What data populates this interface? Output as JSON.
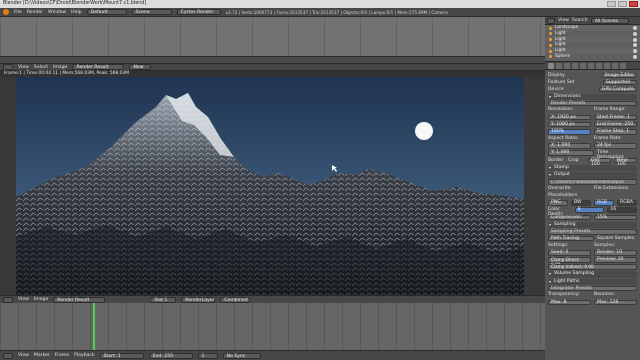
{
  "window": {
    "title": "Blender [D:\\Videos\\CF\\Droid\\BlenderWork\\Mount7.c1.blend]"
  },
  "info_header": {
    "menus": [
      "File",
      "Render",
      "Window",
      "Help"
    ],
    "layout": "Default",
    "scene": "Scene",
    "engine": "Cycles Render",
    "stats": "v2.72 | Verts:1006773 | Faces:2013537 | Tris:2013537 | Objects:0/4 | Lamps:0/1 | Mem:575.69M | Camera"
  },
  "image_editor": {
    "menus": [
      "View",
      "Select",
      "Image"
    ],
    "image_name": "Render Result",
    "slot": "New",
    "info": "Frame:1 | Time:00:04.11 | Mem:568.03M, Peak: 568.03M"
  },
  "bottom_editor": {
    "menus": [
      "View",
      "Image"
    ],
    "image_name": "Render Result",
    "slot": "Slot 1",
    "layer": "RenderLayer",
    "pass": "Combined"
  },
  "timeline": {
    "menus": [
      "View",
      "Marker",
      "Frame",
      "Playback"
    ],
    "start_label": "Start:",
    "start": "1",
    "end_label": "End:",
    "end": "250",
    "current": "1",
    "sync": "No Sync"
  },
  "outliner": {
    "menus": [
      "View",
      "Search"
    ],
    "filter": "All Scenes",
    "items": [
      "Landscape",
      "Light",
      "Light",
      "Light",
      "Light",
      "Sphere"
    ]
  },
  "properties": {
    "display_label": "Display",
    "display": "Image Editor",
    "feature_set_label": "Feature Set",
    "feature_set": "Supported",
    "device_label": "Device",
    "device": "GPU Compute",
    "dimensions": "Dimensions",
    "render_presets": "Render Presets",
    "resolution_label": "Resolution:",
    "frame_range_label": "Frame Range:",
    "res_x": "X:    1920 px",
    "res_y": "Y:    1080 px",
    "res_pct": "100%",
    "start_frame": "Start Frame: 1",
    "end_frame": "End Frame: 250",
    "frame_step": "Frame Step: 1",
    "aspect_ratio_label": "Aspect Ratio:",
    "frame_rate_label": "Frame Rate:",
    "aspect_x": "X:    1.000",
    "aspect_y": "Y:    1.000",
    "frame_rate": "24 fps",
    "time_remap_label": "Time Remapping:",
    "border": "Border",
    "crop": "Crop",
    "old": "Old: 100",
    "new": "New: 100",
    "stamp": "Stamp",
    "output": "Output",
    "output_path": "C:\\Users\\CF\\Videos\\BlenderOutput\\",
    "overwrite": "Overwrite",
    "file_ext": "File Extensions",
    "placeholders": "Placeholders",
    "format": "PNG",
    "color_bw": "BW",
    "color_rgb": "RGB",
    "color_rgba": "RGBA",
    "color_depth_label": "Color Depth:",
    "depth_8": "8",
    "depth_16": "16",
    "compression": "Compression:",
    "compression_val": "15%",
    "sampling": "Sampling",
    "sampling_presets": "Sampling Presets",
    "path_tracing": "Path Tracing",
    "square_samples": "Square Samples",
    "settings_label": "Settings:",
    "samples_label": "Samples:",
    "seed": "Seed: 0",
    "render_samples": "Render: 10",
    "clamp_direct": "Clamp Direct: 0.00",
    "preview_samples": "Preview: 10",
    "clamp_indirect": "Clamp Indirect: 0.00",
    "volume_sampling": "Volume Sampling",
    "light_paths": "Light Paths",
    "integrator_presets": "Integrator Presets",
    "transparency_label": "Transparency:",
    "bounces_label": "Bounces:",
    "trans_max": "Max: 8",
    "bounce_max": "Max: 128"
  },
  "colors": {
    "sky_top": "#1f3451",
    "sky_bottom": "#7fa3bf",
    "accent_blue": "#5680c2",
    "playhead": "#4fd24f"
  }
}
